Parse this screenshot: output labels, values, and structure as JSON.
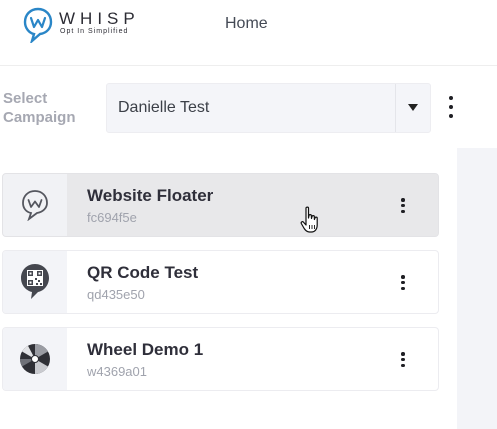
{
  "app": {
    "name": "WHISP",
    "tagline": "Opt In Simplified"
  },
  "nav": {
    "home": "Home"
  },
  "campaign": {
    "label": "Select Campaign",
    "selected": "Danielle Test"
  },
  "items": [
    {
      "name": "Website Floater",
      "id": "fc694f5e",
      "icon": "chat-bubble-icon",
      "hovered": true
    },
    {
      "name": "QR Code Test",
      "id": "qd435e50",
      "icon": "qr-code-icon",
      "hovered": false
    },
    {
      "name": "Wheel Demo 1",
      "id": "w4369a01",
      "icon": "wheel-icon",
      "hovered": false
    }
  ],
  "colors": {
    "brand": "#2a86c7",
    "label_gray": "#a6a8b2",
    "hover_bg": "#e8e8ea"
  }
}
